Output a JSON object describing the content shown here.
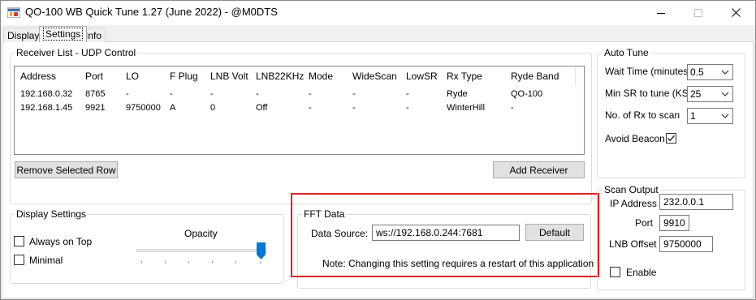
{
  "window": {
    "title": "QO-100 WB Quick Tune 1.27 (June 2022) - @M0DTS",
    "icon": "app-window-icon",
    "controls": [
      "minimize-icon",
      "maximize-icon",
      "close-icon"
    ]
  },
  "tabs": [
    {
      "label": "Display"
    },
    {
      "label": "Settings"
    },
    {
      "label": "Info"
    }
  ],
  "receiver_list": {
    "title": "Receiver List - UDP Control",
    "columns": [
      "Address",
      "Port",
      "LO",
      "F Plug",
      "LNB Volt",
      "LNB22KHz",
      "Mode",
      "WideScan",
      "LowSR",
      "Rx Type",
      "Ryde Band"
    ],
    "rows": [
      [
        "192.168.0.32",
        "8765",
        "-",
        "-",
        "-",
        "-",
        "-",
        "-",
        "-",
        "Ryde",
        "QO-100"
      ],
      [
        "192.168.1.45",
        "9921",
        "9750000",
        "A",
        "0",
        "Off",
        "-",
        "-",
        "-",
        "WinterHill",
        "-"
      ]
    ],
    "remove_button": "Remove Selected Row",
    "add_button": "Add Receiver"
  },
  "auto_tune": {
    "title": "Auto Tune",
    "wait_time_label": "Wait Time (minutes)",
    "wait_time_value": "0.5",
    "min_sr_label": "Min SR to tune (KS)",
    "min_sr_value": "25",
    "num_rx_label": "No. of Rx to scan",
    "num_rx_value": "1",
    "avoid_beacon_label": "Avoid Beacon",
    "avoid_beacon_checked": true
  },
  "display_settings": {
    "title": "Display Settings",
    "always_on_top_label": "Always on Top",
    "always_on_top_checked": false,
    "minimal_label": "Minimal",
    "minimal_checked": false,
    "opacity_label": "Opacity",
    "opacity_value": 1.0
  },
  "fft_data": {
    "title": "FFT Data",
    "source_label": "Data Source:",
    "source_value": "ws://192.168.0.244:7681",
    "default_button": "Default",
    "note": "Note: Changing this setting requires a restart of this application"
  },
  "scan_output": {
    "title": "Scan Output",
    "ip_label": "IP Address",
    "ip_value": "232.0.0.1",
    "port_label": "Port",
    "port_value": "9910",
    "lnb_label": "LNB Offset",
    "lnb_value": "9750000",
    "enable_label": "Enable",
    "enable_checked": false
  },
  "colors": {
    "highlight": "#e02020",
    "slider_thumb": "#0078d7"
  }
}
